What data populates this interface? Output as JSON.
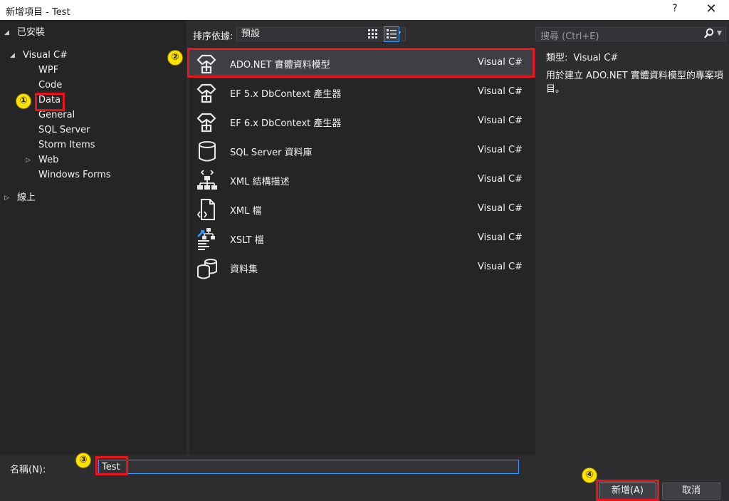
{
  "window": {
    "title": "新增項目 - Test",
    "help": "?",
    "close": "✕"
  },
  "sidebar": {
    "installed": "已安裝",
    "visual_cs": "Visual C#",
    "items": [
      {
        "label": "WPF"
      },
      {
        "label": "Code"
      },
      {
        "label": "Data"
      },
      {
        "label": "General"
      },
      {
        "label": "SQL Server"
      },
      {
        "label": "Storm Items"
      },
      {
        "label": "Web"
      },
      {
        "label": "Windows Forms"
      }
    ],
    "online": "線上"
  },
  "toolbar": {
    "sort_label": "排序依據:",
    "sort_value": "預設"
  },
  "search": {
    "placeholder": "搜尋 (Ctrl+E)"
  },
  "templates": [
    {
      "name": "ADO.NET 實體資料模型",
      "type": "Visual C#",
      "icon": "entity-model-icon"
    },
    {
      "name": "EF 5.x DbContext 產生器",
      "type": "Visual C#",
      "icon": "entity-model-icon"
    },
    {
      "name": "EF 6.x DbContext 產生器",
      "type": "Visual C#",
      "icon": "entity-model-icon"
    },
    {
      "name": "SQL Server 資料庫",
      "type": "Visual C#",
      "icon": "database-icon"
    },
    {
      "name": "XML 結構描述",
      "type": "Visual C#",
      "icon": "xml-schema-icon"
    },
    {
      "name": "XML 檔",
      "type": "Visual C#",
      "icon": "xml-file-icon"
    },
    {
      "name": "XSLT 檔",
      "type": "Visual C#",
      "icon": "xslt-file-icon"
    },
    {
      "name": "資料集",
      "type": "Visual C#",
      "icon": "dataset-icon"
    }
  ],
  "details": {
    "type_label": "類型:",
    "type_value": "Visual C#",
    "description": "用於建立 ADO.NET 實體資料模型的專案項目。"
  },
  "bottom": {
    "name_label": "名稱(N):",
    "name_value": "Test",
    "add_label": "新增(A)",
    "cancel_label": "取消"
  },
  "annotations": [
    "①",
    "②",
    "③",
    "④"
  ],
  "colors": {
    "highlight": "#e8141e",
    "accent": "#3399ff",
    "marker": "#ffe100"
  }
}
